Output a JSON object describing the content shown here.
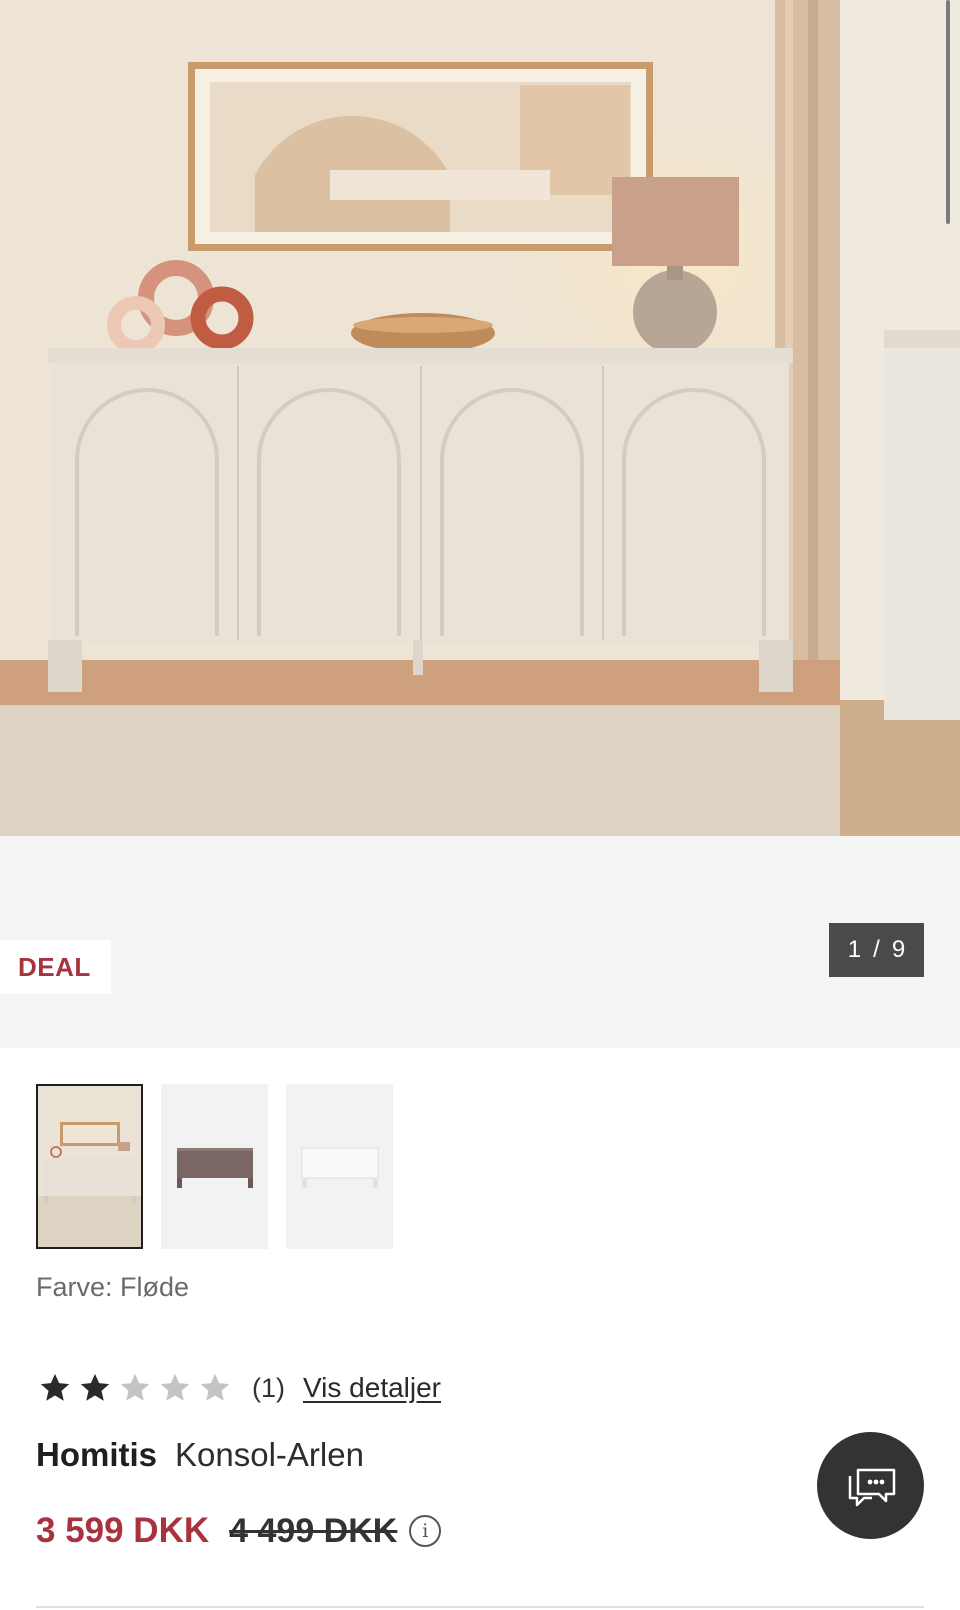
{
  "gallery": {
    "badge": "DEAL",
    "counter": {
      "current": "1",
      "separator": "/",
      "total": "9"
    },
    "hero_alt": "Konsol-Arlen i Fløde"
  },
  "thumbnails": [
    {
      "name": "Fløde",
      "selected": true,
      "color": "#e6e0d7"
    },
    {
      "name": "Brun",
      "selected": false,
      "color": "#7a6763"
    },
    {
      "name": "Hvid",
      "selected": false,
      "color": "#f3f3f3"
    }
  ],
  "color_selection": {
    "label": "Farve: Fløde"
  },
  "rating": {
    "value": 2,
    "max": 5,
    "count_text": "(1)",
    "details_link": "Vis detaljer"
  },
  "product": {
    "brand": "Homitis",
    "name": "Konsol-Arlen"
  },
  "price": {
    "current": "3 599 DKK",
    "original": "4 499 DKK",
    "info_icon": "info-icon"
  },
  "colors": {
    "accent": "#a8323d",
    "dark": "#333333",
    "counter_bg": "#4a4a4a"
  },
  "chat": {
    "icon": "chat-bubbles-icon"
  }
}
